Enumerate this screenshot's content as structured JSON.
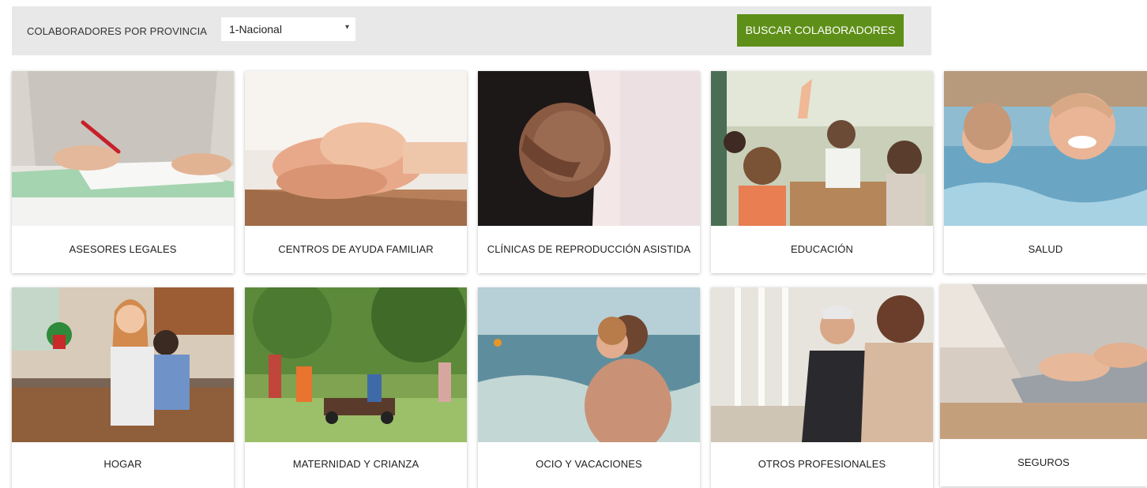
{
  "filter": {
    "label": "COLABORADORES POR PROVINCIA",
    "province_value": "1-Nacional",
    "search_button": "BUSCAR COLABORADORES"
  },
  "categories": [
    {
      "label": "ASESORES LEGALES"
    },
    {
      "label": "CENTROS DE AYUDA FAMILIAR"
    },
    {
      "label": "CLÍNICAS DE REPRODUCCIÓN ASISTIDA"
    },
    {
      "label": "EDUCACIÓN"
    },
    {
      "label": "SALUD"
    },
    {
      "label": "HOGAR"
    },
    {
      "label": "MATERNIDAD Y CRIANZA"
    },
    {
      "label": "OCIO Y VACACIONES"
    },
    {
      "label": "OTROS PROFESIONALES"
    },
    {
      "label": "SEGUROS"
    }
  ],
  "colors": {
    "accent": "#5e8f18",
    "filter_bg": "#e8e8e8"
  },
  "icons": {
    "select_arrow": "chevron-down-icon"
  }
}
